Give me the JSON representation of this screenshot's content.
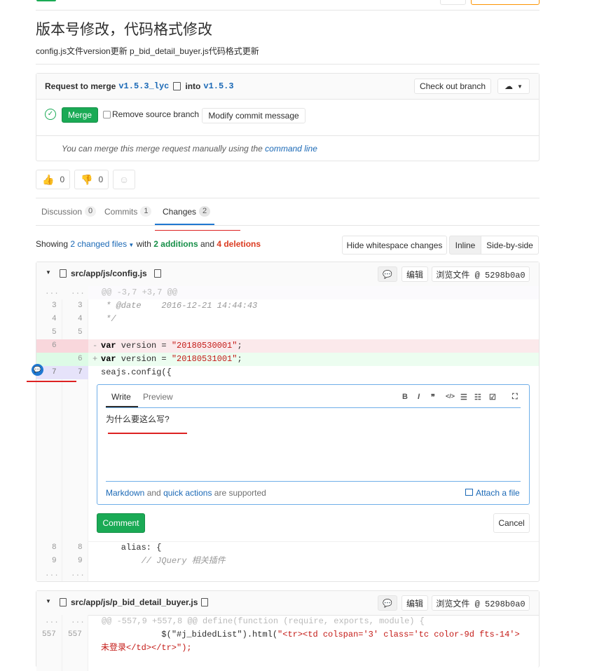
{
  "mr": {
    "title": "版本号修改，代码格式修改",
    "description": "config.js文件version更新 p_bid_detail_buyer.js代码格式更新"
  },
  "merge_widget": {
    "request_to_merge": "Request to merge",
    "source_branch": "v1.5.3_lyc",
    "into": "into",
    "target_branch": "v1.5.3",
    "checkout_button": "Check out branch",
    "merge_button": "Merge",
    "remove_source_label": "Remove source branch",
    "modify_commit_button": "Modify commit message",
    "manual_merge_text": "You can merge this merge request manually using the",
    "command_line_link": "command line"
  },
  "awards": {
    "thumbs_up_count": "0",
    "thumbs_down_count": "0"
  },
  "tabs": [
    {
      "label": "Discussion",
      "count": "0"
    },
    {
      "label": "Commits",
      "count": "1"
    },
    {
      "label": "Changes",
      "count": "2"
    }
  ],
  "diff_stats": {
    "showing": "Showing",
    "changed_files": "2 changed files",
    "with": "with",
    "additions": "2 additions",
    "and": "and",
    "deletions": "4 deletions"
  },
  "view_controls": {
    "hide_whitespace": "Hide whitespace changes",
    "inline": "Inline",
    "side_by_side": "Side-by-side"
  },
  "file1": {
    "path": "src/app/js/config.js",
    "edit_button": "编辑",
    "view_file_button": "浏览文件 @ 5298b0a0",
    "lines": [
      {
        "old": "...",
        "new": "...",
        "text": "@@ -3,7 +3,7 @@"
      },
      {
        "old": "3",
        "new": "3",
        "text": " * @date    2016-12-21 14:44:43"
      },
      {
        "old": "4",
        "new": "4",
        "text": " */"
      },
      {
        "old": "5",
        "new": "5",
        "text": ""
      },
      {
        "old": "6",
        "new": "",
        "text": "var version = \"20180530001\";"
      },
      {
        "old": "",
        "new": "6",
        "text": "var version = \"20180531001\";"
      },
      {
        "old": "7",
        "new": "7",
        "text": "seajs.config({"
      },
      {
        "old": "8",
        "new": "8",
        "text": "    alias: {"
      },
      {
        "old": "9",
        "new": "9",
        "text": "        // JQuery 相关插件"
      },
      {
        "old": "...",
        "new": "...",
        "text": ""
      }
    ]
  },
  "comment_form": {
    "write_tab": "Write",
    "preview_tab": "Preview",
    "text": "为什么要这么写?",
    "markdown_link": "Markdown",
    "and": "and",
    "quick_actions_link": "quick actions",
    "supported": "are supported",
    "attach_file": "Attach a file",
    "comment_button": "Comment",
    "cancel_button": "Cancel"
  },
  "file2": {
    "path": "src/app/js/p_bid_detail_buyer.js",
    "edit_button": "编辑",
    "view_file_button": "浏览文件 @ 5298b0a0",
    "hunk": "@@ -557,9 +557,8 @@ define(function (require, exports, module) {",
    "line_old": "557",
    "line_new": "557",
    "line_code_a": "            $(\"#j_bidedList\").html(",
    "line_code_b": "\"<tr><td colspan='3' class='tc color-9d fts-14'>",
    "line_code_c": "未登录</td></tr>\");"
  },
  "colors": {
    "green": "#1aaa55",
    "link": "#1b69b6",
    "deletion": "#db3b21",
    "addition": "#168f48",
    "removed_line_bg": "#fbe9eb",
    "added_line_bg": "#ecfdf0",
    "annotation_red": "#dd2222"
  }
}
